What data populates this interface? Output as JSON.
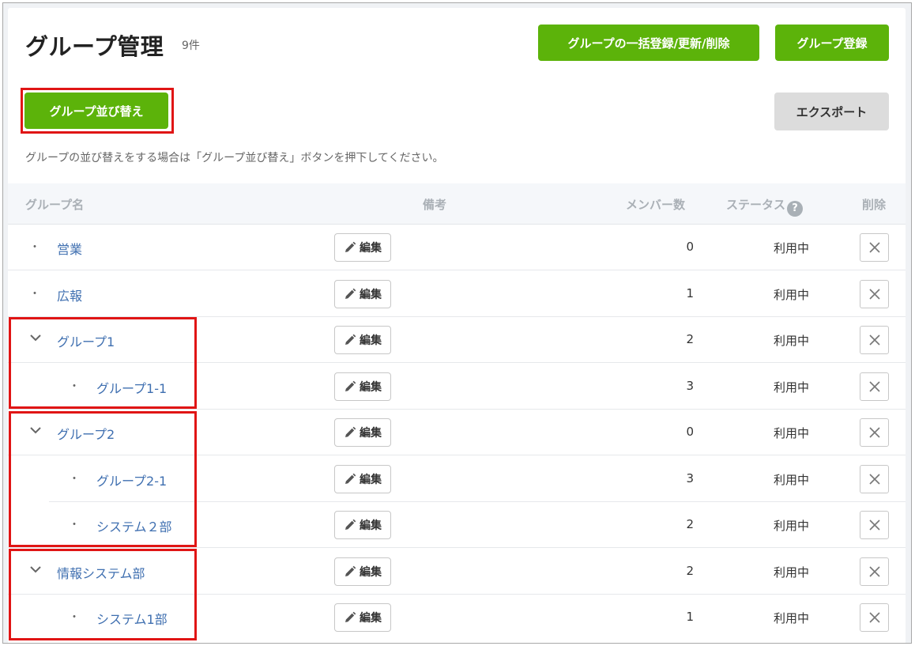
{
  "header": {
    "title": "グループ管理",
    "count": "9件",
    "bulk_button": "グループの一括登録/更新/削除",
    "register_button": "グループ登録"
  },
  "toolbar": {
    "sort_button": "グループ並び替え",
    "export_button": "エクスポート",
    "note": "グループの並び替えをする場合は「グループ並び替え」ボタンを押下してください。"
  },
  "table": {
    "columns": {
      "name": "グループ名",
      "remarks": "備考",
      "members": "メンバー数",
      "status": "ステータス",
      "status_help": "?",
      "delete": "削除"
    },
    "edit_label": "編集",
    "bullet": "・",
    "rows": [
      {
        "name": "営業",
        "members": "0",
        "status": "利用中"
      },
      {
        "name": "広報",
        "members": "1",
        "status": "利用中"
      },
      {
        "name": "グループ1",
        "members": "2",
        "status": "利用中"
      },
      {
        "name": "グループ1-1",
        "members": "3",
        "status": "利用中"
      },
      {
        "name": "グループ2",
        "members": "0",
        "status": "利用中"
      },
      {
        "name": "グループ2-1",
        "members": "3",
        "status": "利用中"
      },
      {
        "name": "システム２部",
        "members": "2",
        "status": "利用中"
      },
      {
        "name": "情報システム部",
        "members": "2",
        "status": "利用中"
      },
      {
        "name": "システム1部",
        "members": "1",
        "status": "利用中"
      }
    ]
  },
  "colors": {
    "primary_green": "#5cb30a",
    "link_blue": "#3f6fb0",
    "highlight_red": "#e01515"
  }
}
